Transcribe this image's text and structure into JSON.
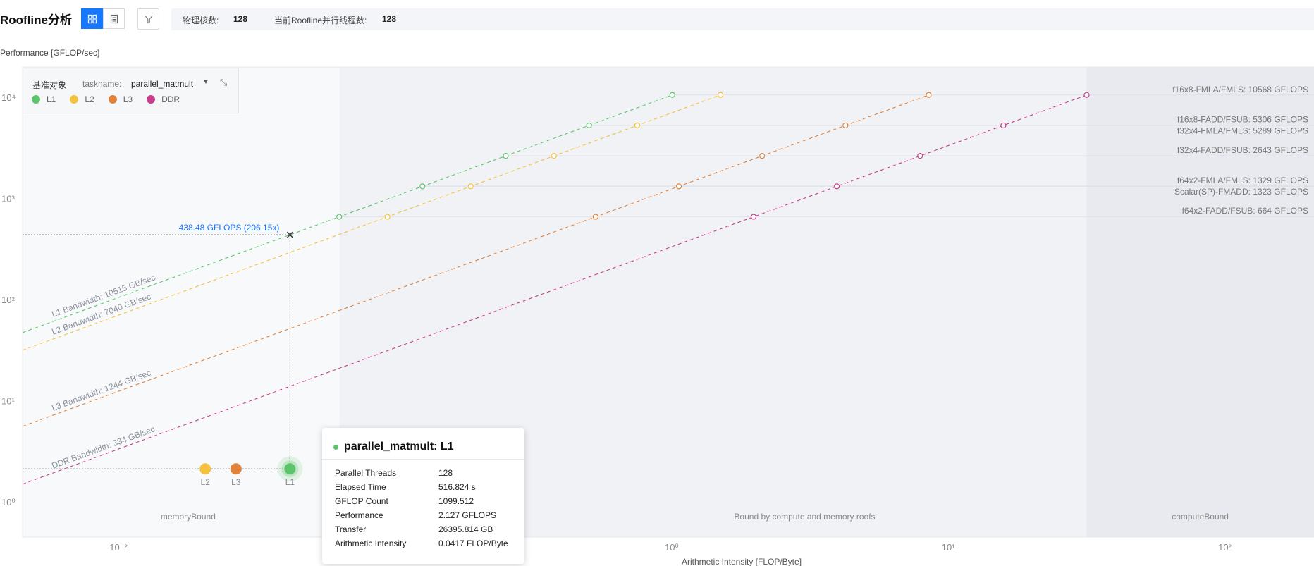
{
  "header": {
    "title": "Roofline分析",
    "physical_cores_label": "物理核数:",
    "physical_cores_value": "128",
    "threads_label": "当前Roofline并行线程数:",
    "threads_value": "128"
  },
  "toolbar": {
    "grid_view_icon": "grid-icon",
    "list_view_icon": "list-icon",
    "filter_icon": "filter-icon"
  },
  "legend": {
    "baseline_label": "基准对象",
    "taskname_key": "taskname:",
    "taskname_value": "parallel_matmult",
    "items": [
      {
        "label": "L1",
        "color": "#5cc46a"
      },
      {
        "label": "L2",
        "color": "#f5c13e"
      },
      {
        "label": "L3",
        "color": "#e0823a"
      },
      {
        "label": "DDR",
        "color": "#c73f8c"
      }
    ]
  },
  "tooltip": {
    "title": "parallel_matmult: L1",
    "rows": [
      {
        "key": "Parallel Threads",
        "value": "128"
      },
      {
        "key": "Elapsed Time",
        "value": "516.824 s"
      },
      {
        "key": "GFLOP Count",
        "value": "1099.512"
      },
      {
        "key": "Performance",
        "value": "2.127 GFLOPS"
      },
      {
        "key": "Transfer",
        "value": "26395.814 GB"
      },
      {
        "key": "Arithmetic Intensity",
        "value": "0.0417 FLOP/Byte"
      }
    ]
  },
  "chart_data": {
    "type": "scatter",
    "xlabel": "Arithmetic Intensity [FLOP/Byte]",
    "ylabel": "Performance [GFLOP/sec]",
    "xscale": "log",
    "yscale": "log",
    "xlim": [
      0.0045,
      210
    ],
    "ylim": [
      0.45,
      20000
    ],
    "x_ticks": [
      {
        "v": 0.01,
        "label": "10⁻²"
      },
      {
        "v": 1,
        "label": "10⁰"
      },
      {
        "v": 10,
        "label": "10¹"
      },
      {
        "v": 100,
        "label": "10²"
      }
    ],
    "y_ticks": [
      {
        "v": 1,
        "label": "10⁰"
      },
      {
        "v": 10,
        "label": "10¹"
      },
      {
        "v": 100,
        "label": "10²"
      },
      {
        "v": 1000,
        "label": "10³"
      },
      {
        "v": 10000,
        "label": "10⁴"
      }
    ],
    "bandwidths": [
      {
        "name": "L1",
        "label": "L1 Bandwidth: 10515 GB/sec",
        "value": 10515,
        "color": "#5cc46a"
      },
      {
        "name": "L2",
        "label": "L2 Bandwidth: 7040 GB/sec",
        "value": 7040,
        "color": "#f5c13e"
      },
      {
        "name": "L3",
        "label": "L3 Bandwidth: 1244 GB/sec",
        "value": 1244,
        "color": "#e0823a"
      },
      {
        "name": "DDR",
        "label": "DDR Bandwidth: 334 GB/sec",
        "value": 334,
        "color": "#c73f8c"
      }
    ],
    "compute_roofs": [
      {
        "label": "f16x8-FMLA/FMLS: 10568 GFLOPS",
        "value": 10568
      },
      {
        "label": "f16x8-FADD/FSUB: 5306 GFLOPS",
        "value": 5306
      },
      {
        "label": "f32x4-FMLA/FMLS: 5289 GFLOPS",
        "value": 5289
      },
      {
        "label": "f32x4-FADD/FSUB: 2643 GFLOPS",
        "value": 2643
      },
      {
        "label": "f64x2-FMLA/FMLS: 1329 GFLOPS",
        "value": 1329
      },
      {
        "label": "Scalar(SP)-FMADD: 1323 GFLOPS",
        "value": 1323
      },
      {
        "label": "f64x2-FADD/FSUB: 664 GFLOPS",
        "value": 664
      }
    ],
    "regions": {
      "memory": "memoryBound",
      "mixed": "Bound by compute and memory roofs",
      "compute": "computeBound"
    },
    "region_bounds": [
      0.063,
      31.6
    ],
    "points": [
      {
        "label": "L2",
        "x": 0.0206,
        "y": 2.127,
        "color": "#f5c13e"
      },
      {
        "label": "L3",
        "x": 0.0266,
        "y": 2.127,
        "color": "#e0823a"
      },
      {
        "label": "L1",
        "x": 0.0417,
        "y": 2.127,
        "color": "#5cc46a"
      }
    ],
    "projection": {
      "x": 0.0417,
      "y": 438.48,
      "label": "438.48 GFLOPS (206.15x)"
    }
  }
}
